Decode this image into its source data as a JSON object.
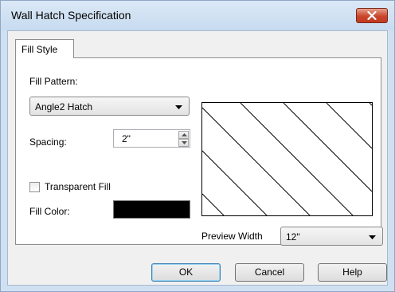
{
  "window": {
    "title": "Wall Hatch Specification"
  },
  "tabs": [
    {
      "label": "Fill Style"
    }
  ],
  "fill_pattern": {
    "label": "Fill Pattern:",
    "selected": "Angle2 Hatch"
  },
  "spacing": {
    "label": "Spacing:",
    "value": "2\""
  },
  "transparent_fill": {
    "label": "Transparent Fill",
    "checked": false
  },
  "fill_color": {
    "label": "Fill Color:",
    "color": "#000000"
  },
  "preview_width": {
    "label": "Preview Width",
    "selected": "12\""
  },
  "buttons": {
    "ok": "OK",
    "cancel": "Cancel",
    "help": "Help"
  }
}
